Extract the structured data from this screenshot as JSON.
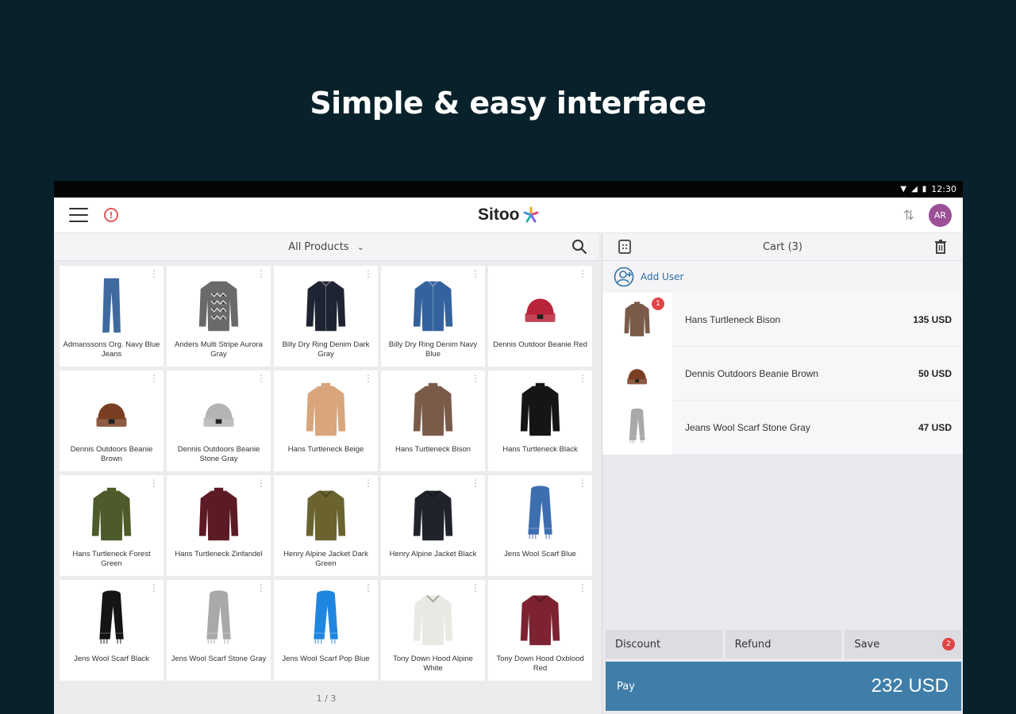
{
  "headline": "Simple & easy interface",
  "statusbar": {
    "time": "12:30"
  },
  "appbar": {
    "logo_text": "Sitoo",
    "avatar_initials": "AR"
  },
  "products": {
    "filter_label": "All Products",
    "pager": "1 / 3",
    "items": [
      {
        "name": "Admanssons Org. Navy Blue Jeans",
        "kind": "jeans",
        "color": "#3f6aa0"
      },
      {
        "name": "Anders Multi Stripe Aurora Gray",
        "kind": "sweater-pattern",
        "color": "#6a6a6a"
      },
      {
        "name": "Billy Dry Ring Denim Dark Gray",
        "kind": "shirt",
        "color": "#1f2433"
      },
      {
        "name": "Billy Dry Ring Denim Navy Blue",
        "kind": "shirt",
        "color": "#33629e"
      },
      {
        "name": "Dennis Outdoor Beanie Red",
        "kind": "beanie",
        "color": "#b8243a"
      },
      {
        "name": "Dennis Outdoors Beanie Brown",
        "kind": "beanie",
        "color": "#7a3f22"
      },
      {
        "name": "Dennis Outdoors Beanie Stone Gray",
        "kind": "beanie",
        "color": "#b4b4b4"
      },
      {
        "name": "Hans Turtleneck Beige",
        "kind": "turtleneck",
        "color": "#d8a57c"
      },
      {
        "name": "Hans Turtleneck Bison",
        "kind": "turtleneck",
        "color": "#7a5b4a"
      },
      {
        "name": "Hans Turtleneck Black",
        "kind": "turtleneck",
        "color": "#151515"
      },
      {
        "name": "Hans Turtleneck Forest Green",
        "kind": "turtleneck",
        "color": "#4d5a2a"
      },
      {
        "name": "Hans Turtleneck Zinfandel",
        "kind": "turtleneck",
        "color": "#5c1a24"
      },
      {
        "name": "Henry Alpine Jacket Dark Green",
        "kind": "jacket",
        "color": "#6a6330"
      },
      {
        "name": "Henry Alpine Jacket Black",
        "kind": "jacket",
        "color": "#20232b"
      },
      {
        "name": "Jens Wool Scarf Blue",
        "kind": "scarf",
        "color": "#3d6fb0"
      },
      {
        "name": "Jens Wool Scarf Black",
        "kind": "scarf",
        "color": "#141414"
      },
      {
        "name": "Jens Wool Scarf Stone Gray",
        "kind": "scarf",
        "color": "#a9a9a9"
      },
      {
        "name": "Jens Wool Scarf Pop Blue",
        "kind": "scarf",
        "color": "#1f86e0"
      },
      {
        "name": "Tony Down Hood Alpine White",
        "kind": "jacket",
        "color": "#e9e9e4"
      },
      {
        "name": "Tony Down Hood Oxblood Red",
        "kind": "jacket",
        "color": "#7d2230"
      }
    ]
  },
  "cart": {
    "title": "Cart (3)",
    "add_user_label": "Add User",
    "items": [
      {
        "name": "Hans Turtleneck Bison",
        "price": "135 USD",
        "kind": "turtleneck",
        "color": "#7a5b4a",
        "qty": "1"
      },
      {
        "name": "Dennis Outdoors Beanie Brown",
        "price": "50 USD",
        "kind": "beanie",
        "color": "#7a3f22",
        "qty": ""
      },
      {
        "name": "Jeans Wool Scarf Stone Gray",
        "price": "47 USD",
        "kind": "scarf",
        "color": "#a9a9a9",
        "qty": ""
      }
    ],
    "actions": {
      "discount": "Discount",
      "refund": "Refund",
      "save": "Save",
      "save_badge": "2"
    },
    "pay_label": "Pay",
    "pay_total": "232 USD"
  }
}
